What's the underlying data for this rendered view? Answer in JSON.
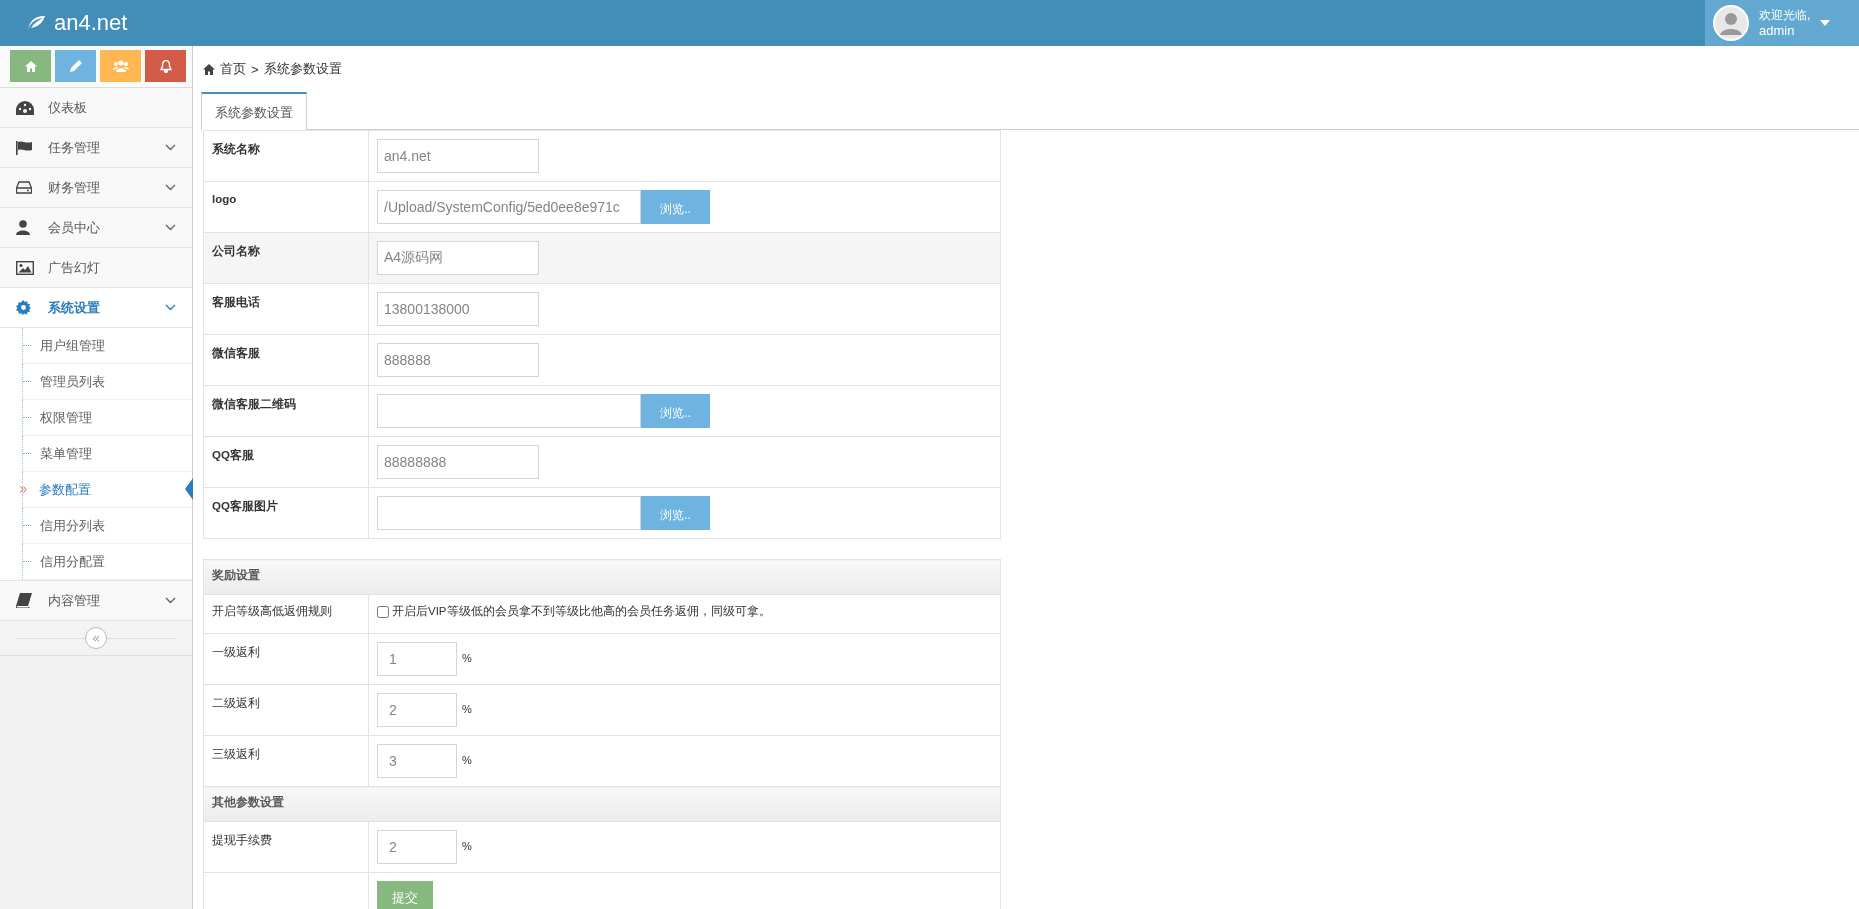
{
  "header": {
    "logo": "an4.net",
    "greeting": "欢迎光临,",
    "username": "admin"
  },
  "shortcuts": [
    {
      "kind": "home",
      "color": "#87b87f"
    },
    {
      "kind": "pencil",
      "color": "#6fb3e0"
    },
    {
      "kind": "users",
      "color": "#ffb752"
    },
    {
      "kind": "bell",
      "color": "#d15b47"
    }
  ],
  "menu": [
    {
      "label": "仪表板",
      "kind": "dashboard",
      "selected": false
    },
    {
      "label": "任务管理",
      "kind": "flag",
      "selected": false,
      "expanded": false
    },
    {
      "label": "财务管理",
      "kind": "drive",
      "selected": false,
      "expanded": false
    },
    {
      "label": "会员中心",
      "kind": "user",
      "selected": false,
      "expanded": false
    },
    {
      "label": "广告幻灯",
      "kind": "picture",
      "selected": false
    },
    {
      "label": "系统设置",
      "kind": "gear",
      "selected": true,
      "expanded": true,
      "children": [
        {
          "label": "用户组管理",
          "selected": false
        },
        {
          "label": "管理员列表",
          "selected": false
        },
        {
          "label": "权限管理",
          "selected": false
        },
        {
          "label": "菜单管理",
          "selected": false
        },
        {
          "label": "参数配置",
          "selected": true
        },
        {
          "label": "信用分列表",
          "selected": false
        },
        {
          "label": "信用分配置",
          "selected": false
        }
      ]
    },
    {
      "label": "内容管理",
      "kind": "book",
      "selected": false,
      "expanded": false
    }
  ],
  "collapse_toggle": "«",
  "breadcrumb": {
    "home": "首页",
    "separator": ">",
    "current": "系统参数设置"
  },
  "tabs": [
    {
      "label": "系统参数设置",
      "selected": true
    }
  ],
  "basic_fields": [
    {
      "label": "系统名称",
      "kind": "text",
      "value": "an4.net",
      "hovered": false
    },
    {
      "label": "logo",
      "kind": "file",
      "value": "/Upload/SystemConfig/5ed0ee8e971c",
      "button": "浏览..",
      "hovered": false
    },
    {
      "label": "公司名称",
      "kind": "text",
      "value": "A4源码网",
      "hovered": true
    },
    {
      "label": "客服电话",
      "kind": "text",
      "value": "13800138000",
      "hovered": false
    },
    {
      "label": "微信客服",
      "kind": "text",
      "value": "888888",
      "hovered": false
    },
    {
      "label": "微信客服二维码",
      "kind": "file",
      "button": "浏览..",
      "hovered": false
    },
    {
      "label": "QQ客服",
      "kind": "text",
      "value": "88888888",
      "hovered": false
    },
    {
      "label": "QQ客服图片",
      "kind": "file",
      "button": "浏览..",
      "hovered": false
    }
  ],
  "sections": [
    {
      "title": "奖励设置",
      "rows": [
        {
          "label": "开启等级高低返佣规则",
          "kind": "checkbox",
          "checked": false,
          "text": "开启后VIP等级低的会员拿不到等级比他高的会员任务返佣，同级可拿。"
        },
        {
          "label": "一级返利",
          "kind": "percent",
          "value": "1",
          "unit": "%"
        },
        {
          "label": "二级返利",
          "kind": "percent",
          "value": "2",
          "unit": "%"
        },
        {
          "label": "三级返利",
          "kind": "percent",
          "value": "3",
          "unit": "%"
        }
      ]
    },
    {
      "title": "其他参数设置",
      "rows": [
        {
          "label": "提现手续费",
          "kind": "percent",
          "value": "2",
          "unit": "%"
        }
      ]
    }
  ],
  "submit": "提交"
}
